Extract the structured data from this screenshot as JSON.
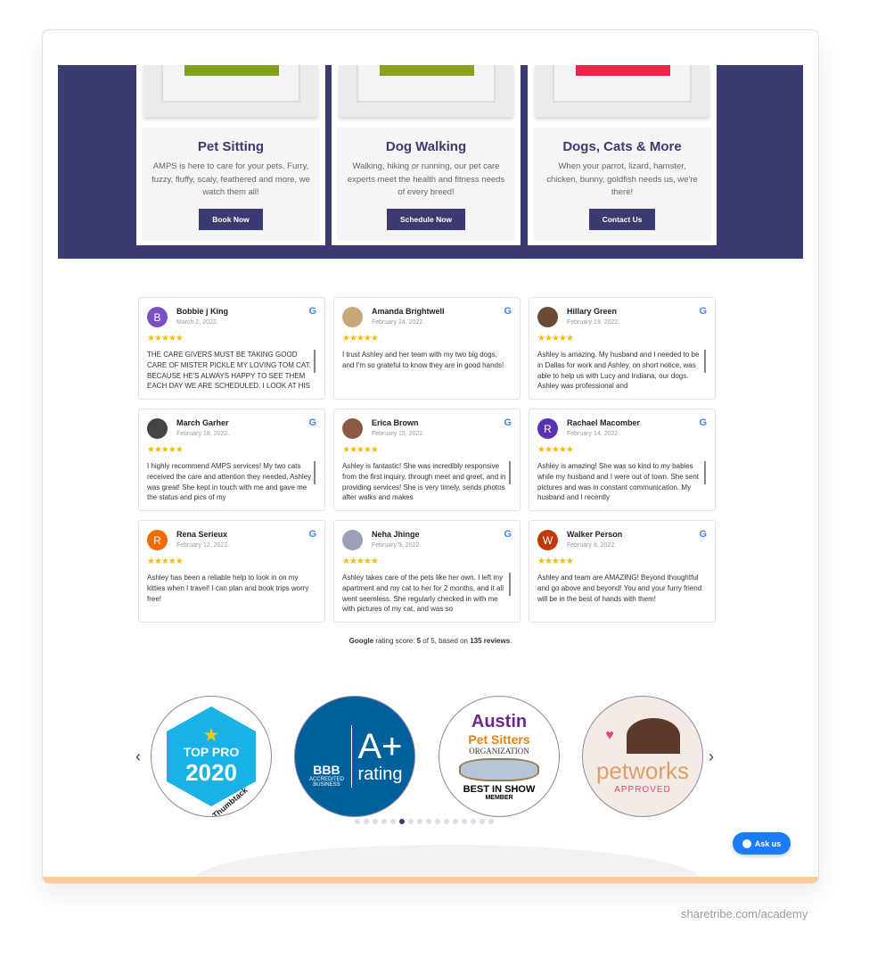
{
  "services": [
    {
      "title": "Pet Sitting",
      "text": "AMPS is here to care for your pets. Furry, fuzzy, fluffy, scaly, feathered and more, we watch them all!",
      "button": "Book Now",
      "photo_color": "#7ea01c"
    },
    {
      "title": "Dog Walking",
      "text": "Walking, hiking or running, our pet care experts meet the health and fitness needs of every breed!",
      "button": "Schedule Now",
      "photo_color": "#8aa021"
    },
    {
      "title": "Dogs, Cats & More",
      "text": "When your parrot, lizard, hamster, chicken, bunny, goldfish needs us, we're there!",
      "button": "Contact Us",
      "photo_color": "#e8284a"
    }
  ],
  "reviews": [
    {
      "name": "Bobbie j King",
      "date": "March 2, 2022.",
      "initial": "B",
      "avatar_color": "#7b4fc4",
      "text": "THE CARE GIVERS MUST BE TAKING GOOD CARE OF MISTER PICKLE MY LOVING TOM CAT. BECAUSE HE'S ALWAYS HAPPY TO SEE THEM EACH DAY WE ARE SCHEDULED. I LOOK AT HIS",
      "scroll": true
    },
    {
      "name": "Amanda Brightwell",
      "date": "February 24, 2022.",
      "initial": "",
      "avatar_color": "#c9a57a",
      "text": "I trust Ashley and her team with my two big dogs, and I'm so grateful to know they are in good hands!",
      "scroll": false
    },
    {
      "name": "Hillary Green",
      "date": "February 19, 2022.",
      "initial": "",
      "avatar_color": "#6b4a36",
      "text": "Ashley is amazing. My husband and I needed to be in Dallas for work and Ashley, on short notice, was able to help us with Lucy and Indiana, our dogs. Ashley was professional and",
      "scroll": true
    },
    {
      "name": "March Garher",
      "date": "February 18, 2022.",
      "initial": "",
      "avatar_color": "#444",
      "text": "I highly recommend AMPS services! My two cats received the care and attention they needed, Ashley was great! She kept in touch with me and gave me the status and pics of my",
      "scroll": true
    },
    {
      "name": "Erica Brown",
      "date": "February 15, 2022.",
      "initial": "",
      "avatar_color": "#8a5a44",
      "text": "Ashley is fantastic! She was incredibly responsive from the first inquiry, through meet and greet, and in providing services! She is very timely, sends photos after walks and makes",
      "scroll": true
    },
    {
      "name": "Rachael Macomber",
      "date": "February 14, 2022.",
      "initial": "R",
      "avatar_color": "#5a31b0",
      "text": "Ashley is amazing! She was so kind to my babies while my husband and I were out of town. She sent pictures and was in constant communication. My husband and I recently",
      "scroll": true
    },
    {
      "name": "Rena Serieux",
      "date": "February 12, 2022.",
      "initial": "R",
      "avatar_color": "#f06c00",
      "text": "Ashley has been a reliable help to look in on my kitties when I travel! I can plan and book trips worry free!",
      "scroll": false
    },
    {
      "name": "Neha Jhinge",
      "date": "February 9, 2022.",
      "initial": "",
      "avatar_color": "#9aa0b8",
      "text": "Ashley takes care of the pets like her own. I left my apartment and my cat to her for 2 months, and it all went seemless. She regularly checked in with me with pictures of my cat, and was so",
      "scroll": true
    },
    {
      "name": "Walker Person",
      "date": "February 8, 2022.",
      "initial": "W",
      "avatar_color": "#c0390b",
      "text": "Ashley and team are AMAZING! Beyond thoughtful and go above and beyond! You and your furry friend will be in the best of hands with them!",
      "scroll": false
    }
  ],
  "stars": "★★★★★",
  "google_icon": "G",
  "rating": {
    "brand": "Google",
    "label": " rating score: ",
    "score": "5",
    "of": " of 5, based on ",
    "count": "135 reviews",
    "end": "."
  },
  "badges": [
    {
      "lines": [
        "TOP PRO",
        "2020",
        "Thumbtack"
      ],
      "bg": "#1ab1e6"
    },
    {
      "lines": [
        "BBB",
        "ACCREDITED BUSINESS",
        "A+",
        "rating"
      ],
      "bg": "#00609b"
    },
    {
      "lines": [
        "Austin",
        "Pet Sitters",
        "ORGANIZATION",
        "BEST IN SHOW",
        "MEMBER"
      ],
      "bg": "#ffffff"
    },
    {
      "lines": [
        "petworks",
        "APPROVED"
      ],
      "bg": "#f4ebe4"
    }
  ],
  "carousel": {
    "dots": 16,
    "active": 6
  },
  "ask_us": "Ask us",
  "footer": "sharetribe.com/academy",
  "colors": {
    "navy": "#3b3b72",
    "accent_orange": "#fdcb98",
    "star": "#f9b906",
    "chat_blue": "#1a7cf7"
  }
}
